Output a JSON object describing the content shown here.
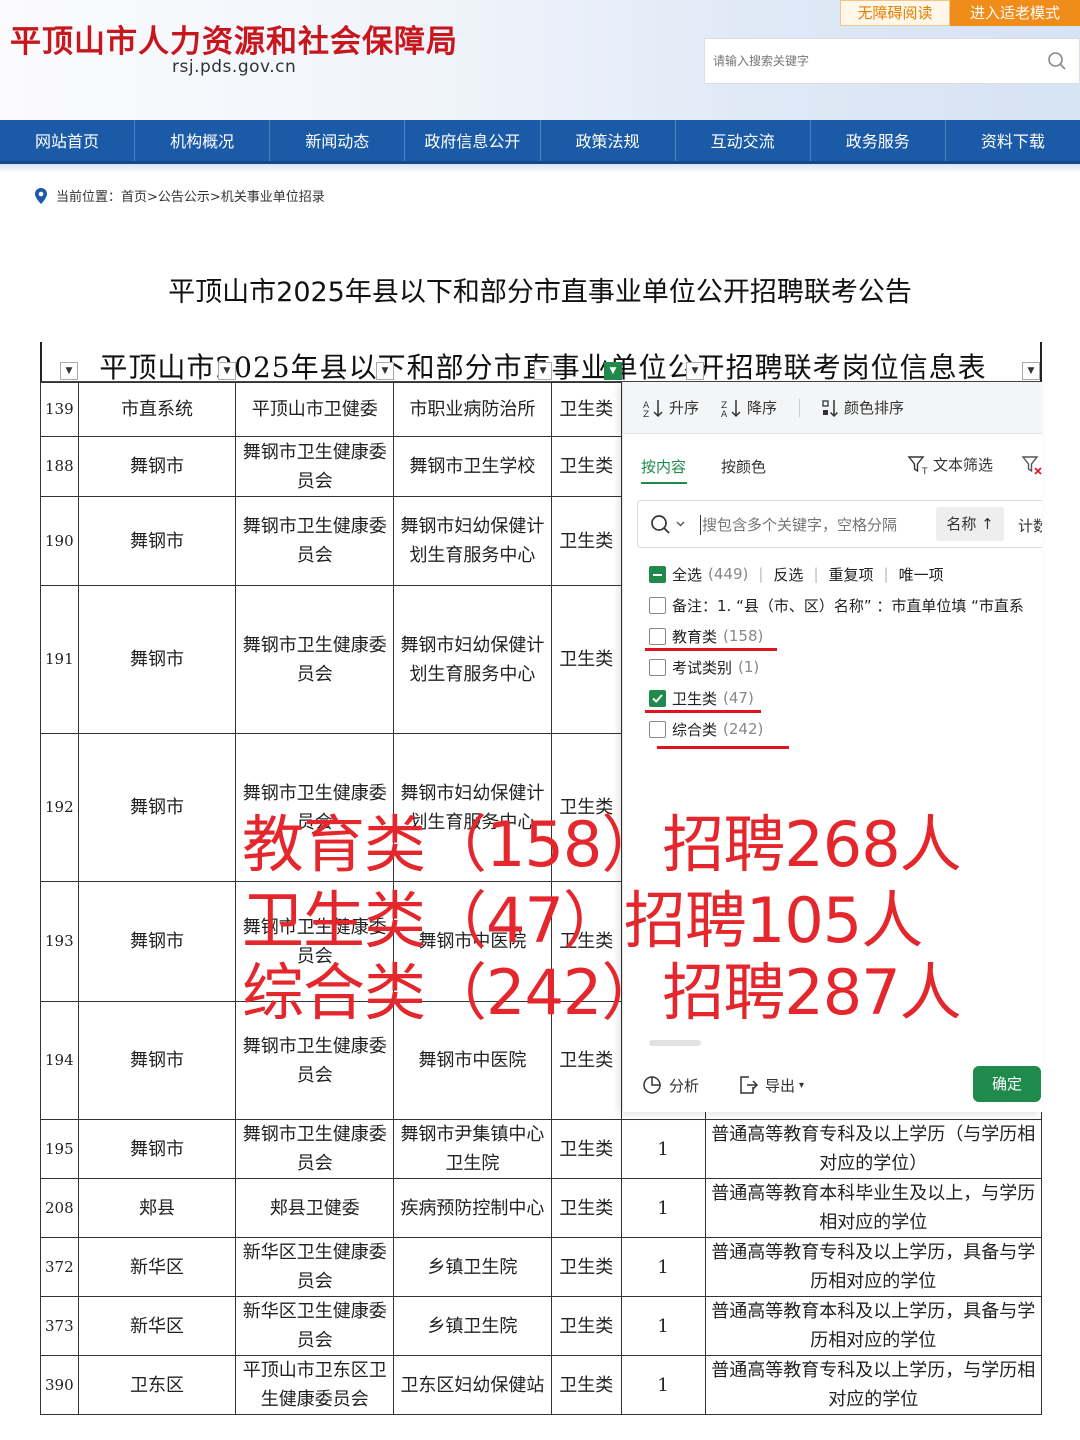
{
  "header": {
    "site_title": "平顶山市人力资源和社会保障局",
    "site_url": "rsj.pds.gov.cn",
    "accessibility_label": "无障碍阅读",
    "elder_mode_label": "进入适老模式",
    "search_placeholder": "请输入搜索关键字"
  },
  "nav": {
    "items": [
      "网站首页",
      "机构概况",
      "新闻动态",
      "政府信息公开",
      "政策法规",
      "互动交流",
      "政务服务",
      "资料下载"
    ]
  },
  "breadcrumb": "当前位置：首页>公告公示>机关事业单位招录",
  "article": {
    "title": "平顶山市2025年县以下和部分市直事业单位公开招聘联考公告"
  },
  "sheet": {
    "title": "平顶山市2025年县以下和部分市直事业单位公开招聘联考岗位信息表",
    "rows": [
      {
        "no": "139",
        "area": "市直系统",
        "dept": "平顶山市卫健委",
        "unit": "市职业病防治所",
        "type": "卫生类",
        "count": "",
        "edu": ""
      },
      {
        "no": "188",
        "area": "舞钢市",
        "dept": "舞钢市卫生健康委员会",
        "unit": "舞钢市卫生学校",
        "type": "卫生类",
        "count": "",
        "edu": ""
      },
      {
        "no": "190",
        "area": "舞钢市",
        "dept": "舞钢市卫生健康委员会",
        "unit": "舞钢市妇幼保健计划生育服务中心",
        "type": "卫生类",
        "count": "",
        "edu": ""
      },
      {
        "no": "191",
        "area": "舞钢市",
        "dept": "舞钢市卫生健康委员会",
        "unit": "舞钢市妇幼保健计划生育服务中心",
        "type": "卫生类",
        "count": "",
        "edu": ""
      },
      {
        "no": "192",
        "area": "舞钢市",
        "dept": "舞钢市卫生健康委员会",
        "unit": "舞钢市妇幼保健计划生育服务中心",
        "type": "卫生类",
        "count": "",
        "edu": ""
      },
      {
        "no": "193",
        "area": "舞钢市",
        "dept": "舞钢市卫生健康委员会",
        "unit": "舞钢市中医院",
        "type": "卫生类",
        "count": "",
        "edu": ""
      },
      {
        "no": "194",
        "area": "舞钢市",
        "dept": "舞钢市卫生健康委员会",
        "unit": "舞钢市中医院",
        "type": "卫生类",
        "count": "",
        "edu": ""
      },
      {
        "no": "195",
        "area": "舞钢市",
        "dept": "舞钢市卫生健康委员会",
        "unit": "舞钢市尹集镇中心卫生院",
        "type": "卫生类",
        "count": "1",
        "edu": "普通高等教育专科及以上学历（与学历相对应的学位）"
      },
      {
        "no": "208",
        "area": "郏县",
        "dept": "郏县卫健委",
        "unit": "疾病预防控制中心",
        "type": "卫生类",
        "count": "1",
        "edu": "普通高等教育本科毕业生及以上，与学历相对应的学位"
      },
      {
        "no": "372",
        "area": "新华区",
        "dept": "新华区卫生健康委员会",
        "unit": "乡镇卫生院",
        "type": "卫生类",
        "count": "1",
        "edu": "普通高等教育专科及以上学历，具备与学历相对应的学位"
      },
      {
        "no": "373",
        "area": "新华区",
        "dept": "新华区卫生健康委员会",
        "unit": "乡镇卫生院",
        "type": "卫生类",
        "count": "1",
        "edu": "普通高等教育本科及以上学历，具备与学历相对应的学位"
      },
      {
        "no": "390",
        "area": "卫东区",
        "dept": "平顶山市卫东区卫生健康委员会",
        "unit": "卫东区妇幼保健站",
        "type": "卫生类",
        "count": "1",
        "edu": "普通高等教育专科及以上学历，与学历相对应的学位"
      }
    ]
  },
  "filter_panel": {
    "sort_asc": "升序",
    "sort_desc": "降序",
    "sort_color": "颜色排序",
    "tab_content": "按内容",
    "tab_color": "按颜色",
    "text_filter": "文本筛选",
    "search_placeholder": "搜包含多个关键字，空格分隔",
    "name_sort": "名称",
    "calc_label": "计数",
    "select_all": "全选",
    "select_all_count": "(449)",
    "invert": "反选",
    "duplicates": "重复项",
    "unique": "唯一项",
    "options": [
      {
        "label": "备注：1. “县（市、区）名称” ：市直单位填 “市直系",
        "count": "",
        "checked": false
      },
      {
        "label": "教育类",
        "count": "(158)",
        "checked": false
      },
      {
        "label": "考试类别",
        "count": "(1)",
        "checked": false
      },
      {
        "label": "卫生类",
        "count": "(47)",
        "checked": true
      },
      {
        "label": "综合类",
        "count": "(242)",
        "checked": false
      }
    ],
    "analyze": "分析",
    "export": "导出",
    "confirm": "确定"
  },
  "overlay": {
    "line1": "教育类（158）招聘268人",
    "line2": "卫生类（47）招聘105人",
    "line3": "综合类（242）招聘287人"
  },
  "colors": {
    "brand_red": "#c8161d",
    "nav_blue": "#1a5aa6",
    "excel_green": "#1f8a4c",
    "annotation_red": "#e4262d",
    "elder_orange": "#f08c1a"
  }
}
